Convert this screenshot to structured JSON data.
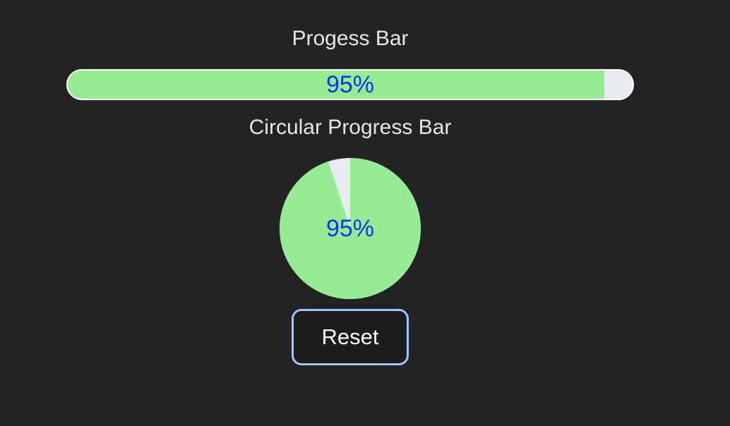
{
  "linear": {
    "title": "Progess Bar",
    "percent": 95,
    "label": "95%"
  },
  "circular": {
    "title": "Circular Progress Bar",
    "percent": 95,
    "label": "95%"
  },
  "reset": {
    "label": "Reset"
  },
  "colors": {
    "background": "#232323",
    "fill": "#95ec95",
    "track": "#e8ebf0",
    "percent_text": "#1133ee",
    "button_border": "#9cc6ff"
  }
}
